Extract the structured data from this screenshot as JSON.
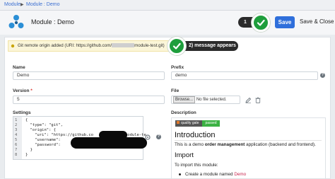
{
  "breadcrumb": {
    "items": [
      "Module",
      "Module : Demo"
    ]
  },
  "header": {
    "title": "Module : Demo",
    "save_label": "Save",
    "save_close_label": "Save & Close"
  },
  "annotations": {
    "step1_label": "1",
    "step2_label": "2) message appears"
  },
  "alert": {
    "message_prefix": "Git remote origin added (URI: https://github.com/",
    "message_suffix": "module-test.git)"
  },
  "form": {
    "name": {
      "label": "Name",
      "value": "Demo"
    },
    "prefix": {
      "label": "Prefix",
      "value": "demo"
    },
    "version": {
      "label": "Version",
      "value": "5"
    },
    "file": {
      "label": "File",
      "browse_label": "Browse...",
      "status": "No file selected."
    },
    "settings": {
      "label": "Settings",
      "line_numbers": [
        "1",
        "2",
        "3",
        "4",
        "5",
        "6",
        "7",
        "8"
      ],
      "lines": [
        "{",
        "  \"type\": \"git\",",
        "  \"origin\": {",
        "    \"uri\": \"https://github.co",
        "    \"username\":",
        "    \"password\":",
        "  }",
        "}"
      ],
      "uri_tail": "module-te"
    },
    "description": {
      "label": "Description",
      "badge_left": "quality gate",
      "badge_right": "passed",
      "heading1": "Introduction",
      "intro_prefix": "This is a demo ",
      "intro_bold": "order management",
      "intro_suffix": " application (backend and frontend).",
      "heading2": "Import",
      "import_text": "To import this module:",
      "bullet_prefix": "Create a module named ",
      "bullet_code": "Demo"
    }
  },
  "colors": {
    "primary": "#2f6fdb",
    "success": "#1e9e3c",
    "alert_bg": "#fbf6d9",
    "required": "#d9322b"
  }
}
